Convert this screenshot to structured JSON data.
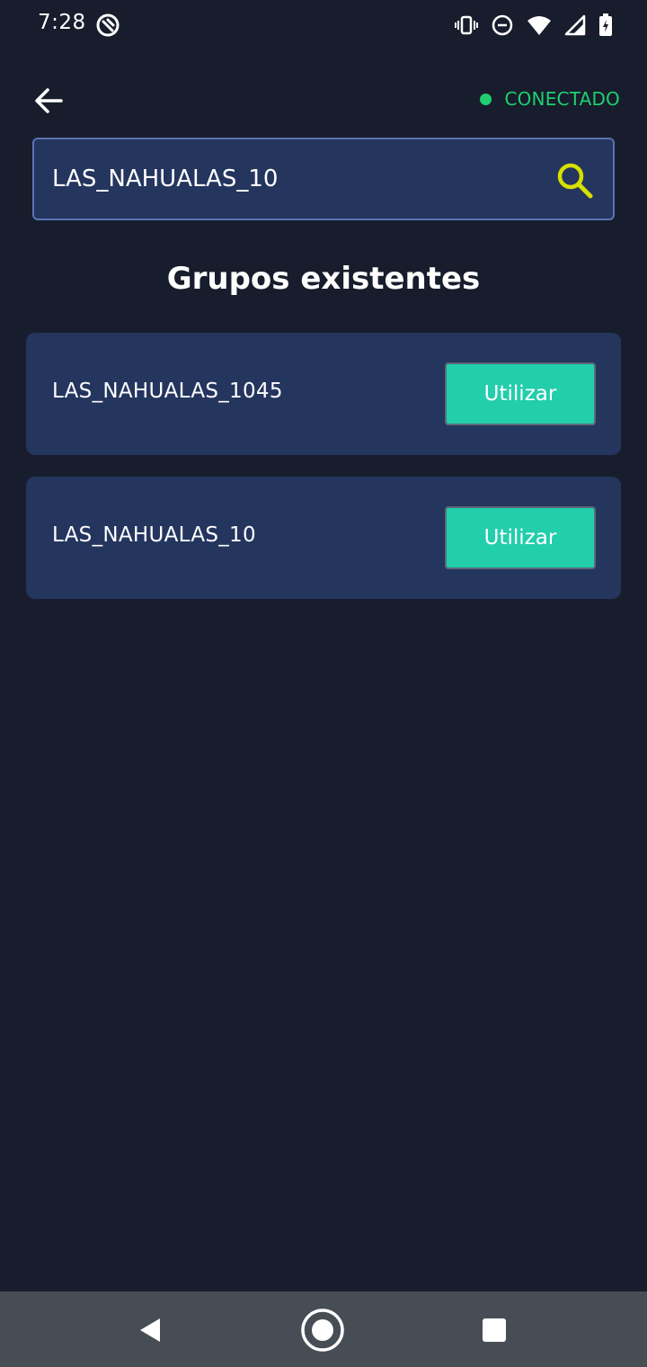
{
  "status_bar": {
    "time": "7:28",
    "icons": [
      "app-notification-icon",
      "vibrate-icon",
      "do-not-disturb-icon",
      "wifi-icon",
      "cell-signal-icon",
      "battery-charging-icon"
    ]
  },
  "header": {
    "back_icon": "arrow-left-icon",
    "connection_status": "CONECTADO",
    "connection_color": "#1fcf70"
  },
  "search": {
    "value": "LAS_NAHUALAS_10",
    "icon": "search-icon",
    "icon_color": "#d6e000"
  },
  "section_title": "Grupos existentes",
  "groups": [
    {
      "name": "LAS_NAHUALAS_1045",
      "button_label": "Utilizar"
    },
    {
      "name": "LAS_NAHUALAS_10",
      "button_label": "Utilizar"
    }
  ],
  "colors": {
    "background": "#171d2c",
    "card": "#24355e",
    "accent_button": "#22ceac"
  },
  "nav_bar": {
    "icons": [
      "nav-back-icon",
      "nav-home-icon",
      "nav-recents-icon"
    ]
  }
}
